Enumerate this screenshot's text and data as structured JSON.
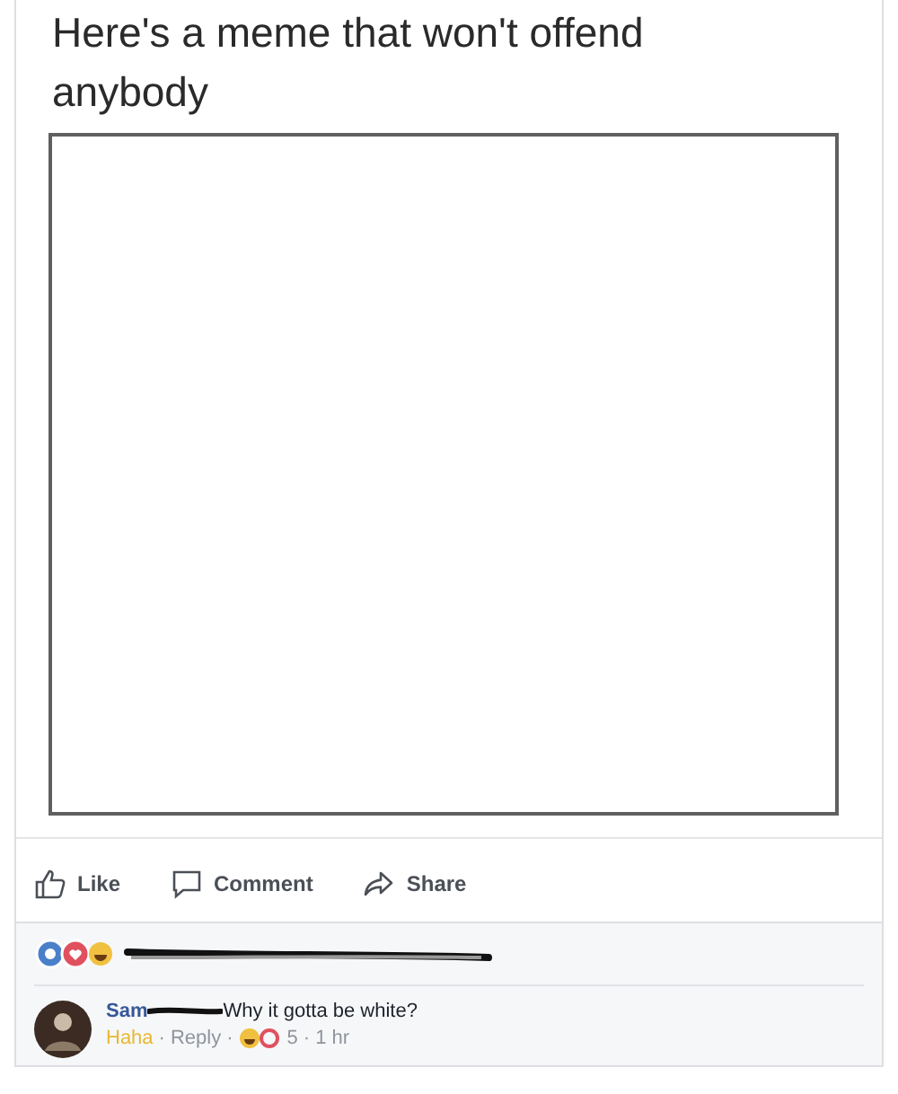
{
  "post": {
    "text": "Here's a meme that won't offend anybody",
    "actions": [
      {
        "kind": "like",
        "label": "Like"
      },
      {
        "kind": "comment",
        "label": "Comment"
      },
      {
        "kind": "share",
        "label": "Share"
      }
    ]
  },
  "comment": {
    "author": "Sam",
    "text": "Why it gotta be white?",
    "meta": [
      {
        "kind": "haha",
        "text": "Haha"
      },
      {
        "kind": "separator",
        "text": "·"
      },
      {
        "kind": "reply",
        "text": "Reply"
      },
      {
        "kind": "separator",
        "text": "·"
      },
      {
        "kind": "reactions",
        "text": "5"
      },
      {
        "kind": "separator",
        "text": "·"
      },
      {
        "kind": "time",
        "text": "1 hr"
      }
    ]
  }
}
